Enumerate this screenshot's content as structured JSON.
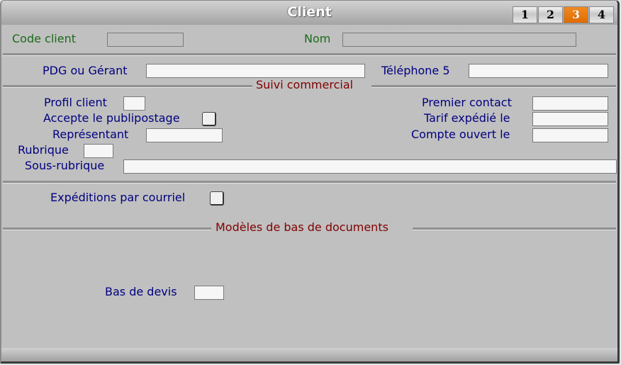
{
  "window": {
    "title": "Client",
    "tabs": [
      {
        "label": "1",
        "active": false
      },
      {
        "label": "2",
        "active": false
      },
      {
        "label": "3",
        "active": true
      },
      {
        "label": "4",
        "active": false
      }
    ]
  },
  "header": {
    "code_client_label": "Code client",
    "code_client_value": "",
    "nom_label": "Nom",
    "nom_value": ""
  },
  "contact": {
    "pdg_label": "PDG ou Gérant",
    "pdg_value": "",
    "telephone5_label": "Téléphone 5",
    "telephone5_value": ""
  },
  "suivi_commercial": {
    "section_title": "Suivi commercial",
    "profil_client_label": "Profil client",
    "profil_client_value": "",
    "publipostage_label": "Accepte le publipostage",
    "publipostage_checked": false,
    "representant_label": "Représentant",
    "representant_value": "",
    "rubrique_label": "Rubrique",
    "rubrique_value": "",
    "sous_rubrique_label": "Sous-rubrique",
    "sous_rubrique_value": "",
    "premier_contact_label": "Premier contact",
    "premier_contact_value": "",
    "tarif_expedie_label": "Tarif expédié le",
    "tarif_expedie_value": "",
    "compte_ouvert_label": "Compte ouvert le",
    "compte_ouvert_value": ""
  },
  "expeditions": {
    "courriel_label": "Expéditions par courriel",
    "courriel_checked": false
  },
  "modeles": {
    "section_title": "Modèles de bas de documents",
    "bas_devis_label": "Bas de devis",
    "bas_devis_value": ""
  },
  "colors": {
    "label_blue": "#000080",
    "label_green": "#1a6b1a",
    "section_red": "#800000",
    "active_tab": "#e87400",
    "background": "#c0c0c0"
  }
}
